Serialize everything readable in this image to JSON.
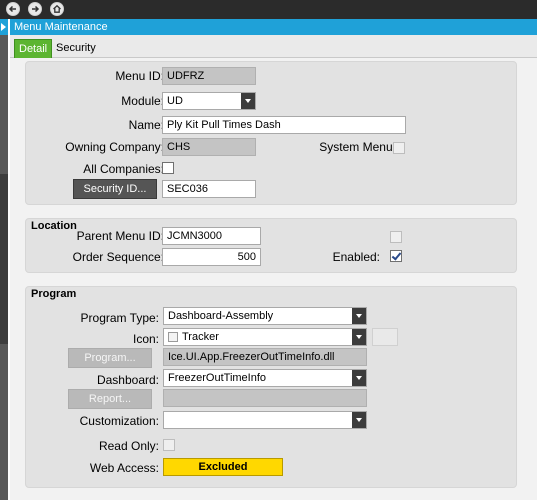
{
  "window": {
    "title": "Menu Maintenance"
  },
  "tabs": [
    {
      "label": "Detail",
      "active": true
    },
    {
      "label": "Security",
      "active": false
    }
  ],
  "general": {
    "menu_id_label": "Menu ID:",
    "menu_id_value": "UDFRZ",
    "module_label": "Module:",
    "module_value": "UD",
    "name_label": "Name:",
    "name_value": "Ply Kit Pull Times Dash",
    "owning_company_label": "Owning Company:",
    "owning_company_value": "CHS",
    "system_menu_label": "System Menu:",
    "system_menu_checked": false,
    "all_companies_label": "All Companies:",
    "all_companies_checked": false,
    "security_id_button": "Security ID...",
    "security_id_value": "SEC036"
  },
  "location": {
    "title": "Location",
    "parent_menu_id_label": "Parent Menu ID:",
    "parent_menu_id_value": "JCMN3000",
    "order_sequence_label": "Order Sequence:",
    "order_sequence_value": "500",
    "enabled_label": "Enabled:",
    "enabled_checked": true
  },
  "program": {
    "title": "Program",
    "program_type_label": "Program Type:",
    "program_type_value": "Dashboard-Assembly",
    "icon_label": "Icon:",
    "icon_value": "Tracker",
    "program_button": "Program...",
    "program_value": "Ice.UI.App.FreezerOutTimeInfo.dll",
    "dashboard_label": "Dashboard:",
    "dashboard_value": "FreezerOutTimeInfo",
    "report_button": "Report...",
    "report_value": "",
    "customization_label": "Customization:",
    "customization_value": "",
    "read_only_label": "Read Only:",
    "read_only_checked": false,
    "web_access_label": "Web Access:",
    "web_access_value": "Excluded"
  },
  "colors": {
    "title_bar": "#1fa1d8",
    "active_tab": "#5cb531",
    "web_access_badge": "#ffd800"
  }
}
